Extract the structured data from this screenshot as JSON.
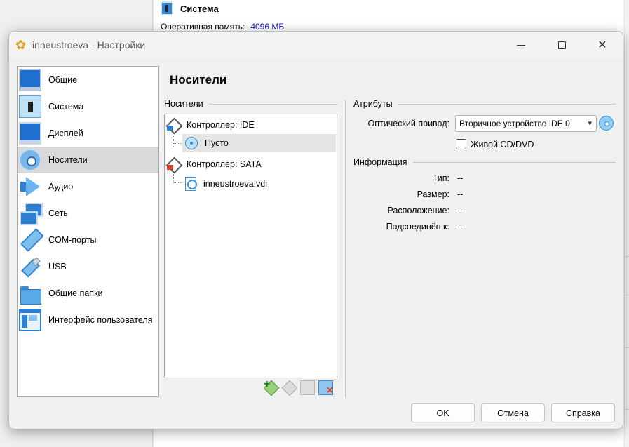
{
  "background": {
    "section_title": "Система",
    "memory_label": "Оперативная память:",
    "memory_value": "4096 МБ"
  },
  "dialog": {
    "title": "inneustroeva - Настройки",
    "categories": [
      {
        "label": "Общие",
        "icon": "monitor-general-icon"
      },
      {
        "label": "Система",
        "icon": "chip-icon"
      },
      {
        "label": "Дисплей",
        "icon": "display-icon"
      },
      {
        "label": "Носители",
        "icon": "storage-disc-icon",
        "selected": true
      },
      {
        "label": "Аудио",
        "icon": "speaker-icon"
      },
      {
        "label": "Сеть",
        "icon": "network-icon"
      },
      {
        "label": "COM-порты",
        "icon": "serial-port-icon"
      },
      {
        "label": "USB",
        "icon": "usb-icon"
      },
      {
        "label": "Общие папки",
        "icon": "folder-icon"
      },
      {
        "label": "Интерфейс пользователя",
        "icon": "ui-window-icon"
      }
    ],
    "page_title": "Носители",
    "storage": {
      "group_label": "Носители",
      "tree": [
        {
          "label": "Контроллер: IDE",
          "type": "controller"
        },
        {
          "label": "Пусто",
          "type": "optical",
          "selected": true
        },
        {
          "label": "Контроллер: SATA",
          "type": "controller"
        },
        {
          "label": "inneustroeva.vdi",
          "type": "disk"
        }
      ]
    },
    "attributes": {
      "group_label": "Атрибуты",
      "optical_drive_label": "Оптический привод:",
      "optical_drive_value": "Вторичное устройство IDE 0",
      "live_cd_label": "Живой CD/DVD",
      "live_cd_checked": false
    },
    "information": {
      "group_label": "Информация",
      "rows": [
        {
          "label": "Тип:",
          "value": "--"
        },
        {
          "label": "Размер:",
          "value": "--"
        },
        {
          "label": "Расположение:",
          "value": "--"
        },
        {
          "label": "Подсоединён к:",
          "value": "--"
        }
      ]
    },
    "buttons": {
      "ok": "OK",
      "cancel": "Отмена",
      "help": "Справка"
    }
  },
  "colors": {
    "accent": "#2f7fd0",
    "selection": "#d9d9d9",
    "link_value": "#1a1ab0"
  }
}
